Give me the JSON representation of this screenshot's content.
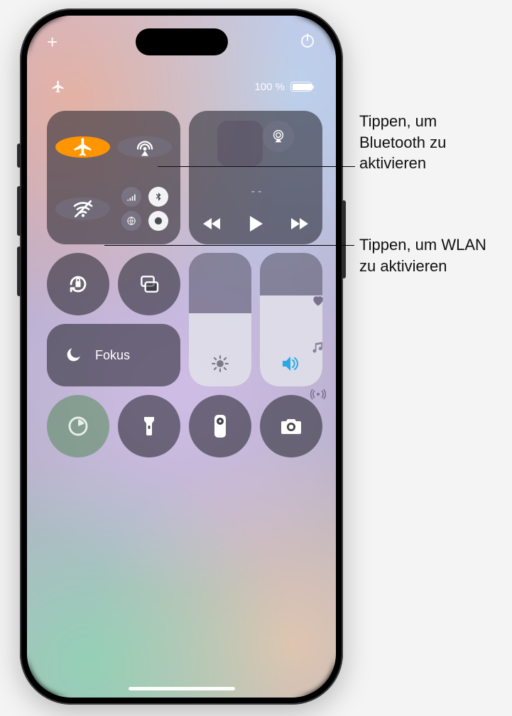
{
  "status": {
    "plus_glyph": "+",
    "battery_text": "100 %",
    "battery_fill_pct": 100
  },
  "connectivity": {
    "airplane_name": "airplane-mode",
    "airdrop_name": "airdrop",
    "wifi_name": "wifi",
    "cellular_name": "cellular-data",
    "bluetooth_name": "bluetooth"
  },
  "media": {
    "title": "- -"
  },
  "focus": {
    "label": "Fokus"
  },
  "sliders": {
    "brightness_pct": 55,
    "volume_pct": 68
  },
  "callouts": {
    "bluetooth": "Tippen, um Bluetooth zu aktivieren",
    "wlan": "Tippen, um WLAN zu aktivieren"
  }
}
